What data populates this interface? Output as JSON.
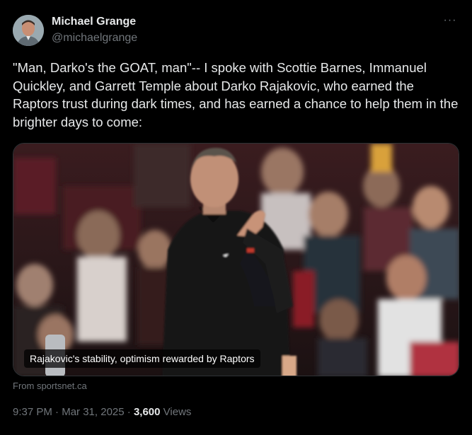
{
  "author": {
    "name": "Michael Grange",
    "handle": "@michaelgrange",
    "avatar_icon": "profile-photo"
  },
  "more_icon": "ellipsis-icon",
  "tweet": {
    "text": "\"Man, Darko's the GOAT, man\"-- I spoke with Scottie Barnes, Immanuel Quickley, and Garrett Temple about Darko Rajakovic, who earned the Raptors trust during dark times, and has earned a chance to help them in the brighter days to come:"
  },
  "link_card": {
    "title": "Rajakovic's stability, optimism rewarded by Raptors",
    "source": "From sportsnet.ca",
    "image": "photo of coach on sideline in front of crowd"
  },
  "meta": {
    "time": "9:37 PM",
    "separator": "·",
    "date": "Mar 31, 2025",
    "views_count": "3,600",
    "views_label": "Views"
  },
  "colors": {
    "background": "#000000",
    "text": "#e7e9ea",
    "muted": "#71767b",
    "border": "#2f3336"
  }
}
